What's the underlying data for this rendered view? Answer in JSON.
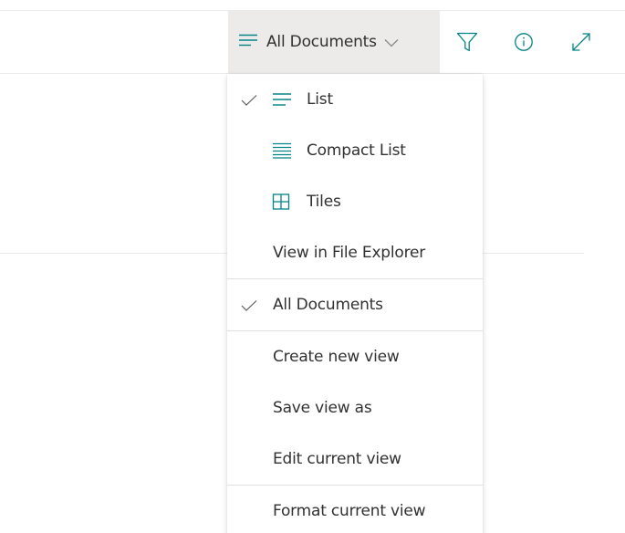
{
  "command_bar": {
    "view_label": "All Documents",
    "icons": {
      "view": "lines-icon",
      "chevron": "chevron-down-icon",
      "filter": "filter-icon",
      "info": "info-icon",
      "expand": "expand-icon"
    }
  },
  "menu": {
    "layout_options": [
      {
        "label": "List",
        "icon": "list-icon",
        "checked": true
      },
      {
        "label": "Compact List",
        "icon": "compact-list-icon",
        "checked": false
      },
      {
        "label": "Tiles",
        "icon": "tiles-icon",
        "checked": false
      }
    ],
    "file_explorer_label": "View in File Explorer",
    "views": [
      {
        "label": "All Documents",
        "checked": true
      }
    ],
    "actions": [
      {
        "label": "Create new view"
      },
      {
        "label": "Save view as"
      },
      {
        "label": "Edit current view"
      }
    ],
    "format_label": "Format current view"
  },
  "colors": {
    "accent": "#038387",
    "text": "#323130",
    "selected_bg": "#edebe9",
    "icon_gray": "#605e5c"
  }
}
